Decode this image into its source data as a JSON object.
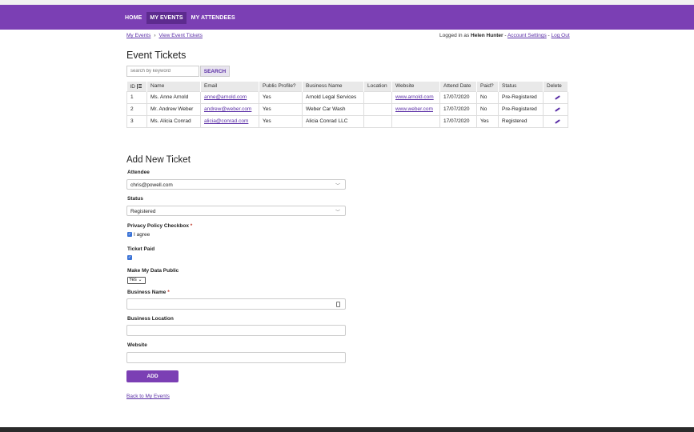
{
  "nav": {
    "items": [
      {
        "label": "HOME"
      },
      {
        "label": "MY EVENTS"
      },
      {
        "label": "MY ATTENDEES"
      }
    ]
  },
  "breadcrumb": {
    "my_events": "My Events",
    "separator": "›",
    "view_tickets": "View Event Tickets"
  },
  "userbar": {
    "prefix": "Logged in as",
    "user": "Helen Hunter",
    "dash1": "-",
    "account_settings": "Account Settings",
    "dash2": "-",
    "logout": "Log Out"
  },
  "tickets": {
    "title": "Event Tickets",
    "search_placeholder": "search by keyword",
    "search_label": "SEARCH",
    "columns": [
      "ID",
      "Name",
      "Email",
      "Public Profile?",
      "Business Name",
      "Location",
      "Website",
      "Attend Date",
      "Paid?",
      "Status",
      "Delete"
    ],
    "rows": [
      {
        "id": "1",
        "name": "Ms. Anne Arnold",
        "email": "anne@arnold.com",
        "public": "Yes",
        "business": "Arnold Legal Services",
        "location": "",
        "website": "www.arnold.com",
        "date": "17/07/2020",
        "paid": "No",
        "status": "Pre-Registered"
      },
      {
        "id": "2",
        "name": "Mr. Andrew Weber",
        "email": "andrew@weber.com",
        "public": "Yes",
        "business": "Weber Car Wash",
        "location": "",
        "website": "www.weber.com",
        "date": "17/07/2020",
        "paid": "No",
        "status": "Pre-Registered"
      },
      {
        "id": "3",
        "name": "Ms. Alicia Conrad",
        "email": "alicia@conrad.com",
        "public": "Yes",
        "business": "Alicia Conrad LLC",
        "location": "",
        "website": "",
        "date": "17/07/2020",
        "paid": "Yes",
        "status": "Registered"
      }
    ]
  },
  "form": {
    "title": "Add New Ticket",
    "attendee_label": "Attendee",
    "attendee_value": "chris@powell.com",
    "status_label": "Status",
    "status_value": "Registered",
    "privacy_label": "Privacy Policy Checkbox",
    "required_mark": "*",
    "privacy_check_label": "I agree",
    "paid_label": "Ticket Paid",
    "public_label": "Make My Data Public",
    "public_value": "Yes",
    "business_name_label": "Business Name",
    "business_location_label": "Business Location",
    "website_label": "Website",
    "add_label": "ADD",
    "back_label": "Back to My Events"
  }
}
